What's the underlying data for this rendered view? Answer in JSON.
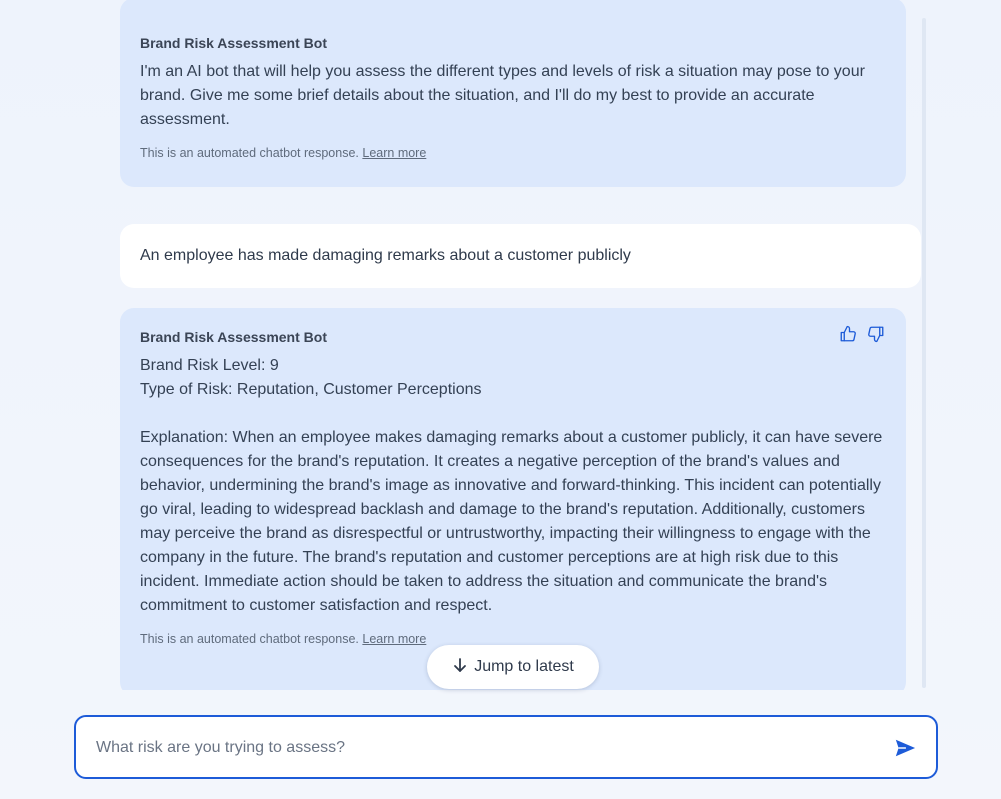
{
  "conversation": {
    "messages": [
      {
        "sender": "Brand Risk Assessment Bot",
        "text": "I'm an AI bot that will help you assess the different types and levels of risk a situation may pose to your brand. Give me some brief details about the situation, and I'll do my best to provide an accurate assessment.",
        "note": "This is an automated chatbot response.",
        "note_link": "Learn more"
      },
      {
        "sender": "user",
        "text": "An employee has made damaging remarks about a customer publicly"
      },
      {
        "sender": "Brand Risk Assessment Bot",
        "risk_level": "Brand Risk Level: 9",
        "risk_type": "Type of Risk: Reputation, Customer Perceptions",
        "explanation": "Explanation: When an employee makes damaging remarks about a customer publicly, it can have severe consequences for the brand's reputation. It creates a negative perception of the brand's values and behavior, undermining the brand's image as innovative and forward-thinking. This incident can potentially go viral, leading to widespread backlash and damage to the brand's reputation. Additionally, customers may perceive the brand as disrespectful or untrustworthy, impacting their willingness to engage with the company in the future. The brand's reputation and customer perceptions are at high risk due to this incident. Immediate action should be taken to address the situation and communicate the brand's commitment to customer satisfaction and respect.",
        "note": "This is an automated chatbot response.",
        "note_link": "Learn more",
        "feedback_icons": [
          "thumbs-up-icon",
          "thumbs-down-icon"
        ]
      }
    ]
  },
  "jump_button": {
    "label": "Jump to latest",
    "icon": "arrow-down-icon"
  },
  "composer": {
    "placeholder": "What risk are you trying to assess?",
    "value": "",
    "send_icon": "send-icon"
  },
  "colors": {
    "bot_bubble": "#dce8fc",
    "user_bubble": "#ffffff",
    "accent": "#1d5bd8",
    "background": "#eef3fb"
  }
}
